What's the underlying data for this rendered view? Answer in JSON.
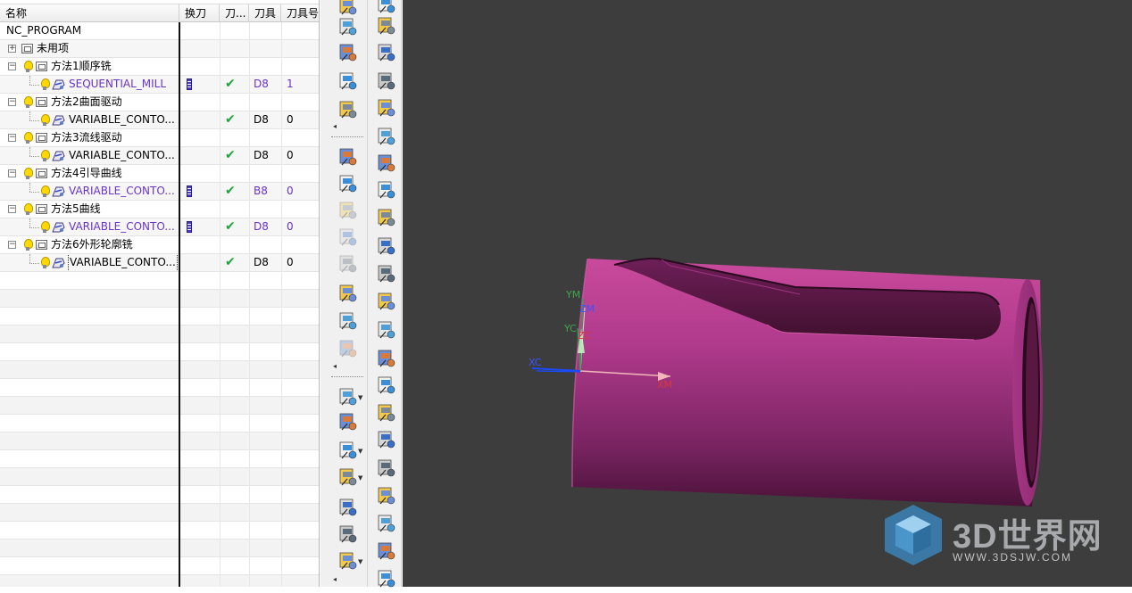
{
  "navigator": {
    "columns": [
      "名称",
      "换刀",
      "刀...",
      "刀具",
      "刀具号"
    ],
    "rows": [
      {
        "name": "NC_PROGRAM",
        "tool": "",
        "tool_num": "",
        "kind": "root"
      },
      {
        "name": "未用项",
        "tool": "",
        "tool_num": "",
        "kind": "group-top"
      },
      {
        "name": "方法1顺序铣",
        "tool": "",
        "tool_num": "",
        "kind": "group"
      },
      {
        "name": "SEQUENTIAL_MILL",
        "tool": "D8",
        "tool_num": "1",
        "kind": "op",
        "purple": true,
        "tool_change": true,
        "path_ok": true
      },
      {
        "name": "方法2曲面驱动",
        "tool": "",
        "tool_num": "",
        "kind": "group"
      },
      {
        "name": "VARIABLE_CONTO...",
        "tool": "D8",
        "tool_num": "0",
        "kind": "op",
        "purple": false,
        "tool_change": false,
        "path_ok": true
      },
      {
        "name": "方法3流线驱动",
        "tool": "",
        "tool_num": "",
        "kind": "group"
      },
      {
        "name": "VARIABLE_CONTO...",
        "tool": "D8",
        "tool_num": "0",
        "kind": "op",
        "purple": false,
        "tool_change": false,
        "path_ok": true
      },
      {
        "name": "方法4引导曲线",
        "tool": "",
        "tool_num": "",
        "kind": "group"
      },
      {
        "name": "VARIABLE_CONTO...",
        "tool": "B8",
        "tool_num": "0",
        "kind": "op",
        "purple": true,
        "tool_change": true,
        "path_ok": true
      },
      {
        "name": "方法5曲线",
        "tool": "",
        "tool_num": "",
        "kind": "group"
      },
      {
        "name": "VARIABLE_CONTO...",
        "tool": "D8",
        "tool_num": "0",
        "kind": "op",
        "purple": true,
        "tool_change": true,
        "path_ok": true
      },
      {
        "name": "方法6外形轮廓铣",
        "tool": "",
        "tool_num": "",
        "kind": "group"
      },
      {
        "name": "VARIABLE_CONTO...",
        "tool": "D8",
        "tool_num": "0",
        "kind": "op",
        "purple": false,
        "tool_change": false,
        "path_ok": true,
        "selected": true
      }
    ],
    "empty_rows": 18
  },
  "viewport": {
    "background": "#3d3d3d",
    "part_color": "#b03a8c",
    "axis_labels": {
      "ym": "YM",
      "zm": "ZM",
      "yc": "YC",
      "zc": "ZC",
      "xm": "XM",
      "xc": "XC"
    },
    "watermark_brand": "3D世界网",
    "watermark_url": "WWW.3DSJW.COM"
  }
}
